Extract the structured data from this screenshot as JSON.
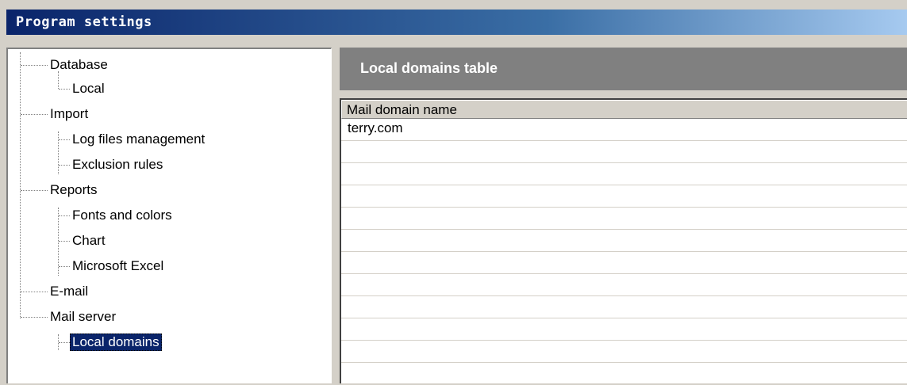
{
  "window": {
    "title": "Program settings"
  },
  "tree": {
    "items": [
      {
        "label": "Database",
        "level": 0
      },
      {
        "label": "Local",
        "level": 1
      },
      {
        "label": "Import",
        "level": 0
      },
      {
        "label": "Log files management",
        "level": 1
      },
      {
        "label": "Exclusion rules",
        "level": 1
      },
      {
        "label": "Reports",
        "level": 0
      },
      {
        "label": "Fonts and colors",
        "level": 1
      },
      {
        "label": "Chart",
        "level": 1
      },
      {
        "label": "Microsoft Excel",
        "level": 1
      },
      {
        "label": "E-mail",
        "level": 0
      },
      {
        "label": "Mail server",
        "level": 0
      },
      {
        "label": "Local domains",
        "level": 1,
        "selected": true
      }
    ]
  },
  "panel": {
    "title": "Local domains table",
    "table": {
      "columns": [
        "Mail domain name"
      ],
      "rows": [
        [
          "terry.com"
        ]
      ]
    }
  },
  "colors": {
    "title_bar_start": "#0a246a",
    "title_bar_end": "#a6caf0",
    "panel_header": "#808080",
    "selection": "#0a246a",
    "window_face": "#d4d0c8"
  }
}
